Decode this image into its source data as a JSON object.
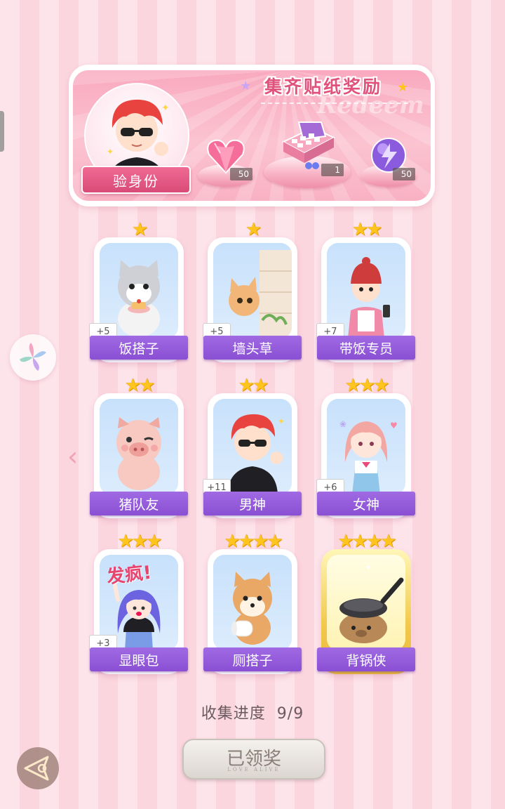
{
  "banner": {
    "title": "集齐贴纸奖励",
    "script_text": "Redeem",
    "verify_label": "验身份",
    "rewards": [
      {
        "icon": "pink-heart-gem-icon",
        "count": "50"
      },
      {
        "icon": "gift-box-icon",
        "count": "1"
      },
      {
        "icon": "purple-energy-orb-icon",
        "count": "50"
      }
    ]
  },
  "cards": [
    {
      "name": "饭搭子",
      "stars": "★",
      "bonus": "+5",
      "icon": "cat-with-cake-icon"
    },
    {
      "name": "墙头草",
      "stars": "★",
      "bonus": "+5",
      "icon": "cat-peeking-wall-icon"
    },
    {
      "name": "带饭专员",
      "stars": "★★",
      "bonus": "+7",
      "icon": "girl-with-beanie-icon"
    },
    {
      "name": "猪队友",
      "stars": "★★",
      "bonus": "",
      "icon": "pig-winking-icon"
    },
    {
      "name": "男神",
      "stars": "★★",
      "bonus": "+11",
      "icon": "red-hair-boy-icon"
    },
    {
      "name": "女神",
      "stars": "★★★",
      "bonus": "+6",
      "icon": "pink-hair-girl-icon"
    },
    {
      "name": "显眼包",
      "stars": "★★★",
      "bonus": "+3",
      "icon": "crazy-girl-icon",
      "art_text": "发疯!"
    },
    {
      "name": "厕搭子",
      "stars": "★★★★",
      "bonus": "",
      "icon": "shiba-toilet-paper-icon"
    },
    {
      "name": "背锅侠",
      "stars": "★★★★",
      "bonus": "",
      "icon": "capybara-pan-icon"
    }
  ],
  "progress": {
    "label": "收集进度",
    "value": "9/9"
  },
  "claim_button": {
    "label": "已领奖",
    "sub": "LOVE ALIVE"
  },
  "colors": {
    "accent_pink": "#e0527c",
    "name_purple": "#8a4fd3",
    "star_gold": "#ffc51e"
  }
}
